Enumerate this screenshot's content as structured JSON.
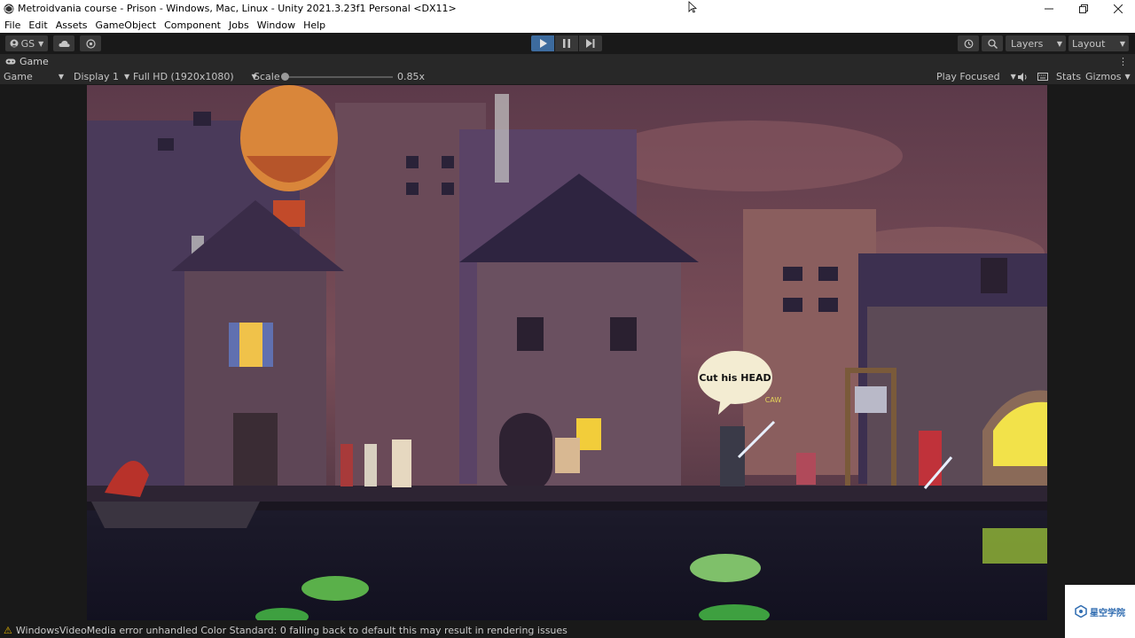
{
  "window": {
    "title": "Metroidvania course - Prison - Windows, Mac, Linux - Unity 2021.3.23f1 Personal <DX11>",
    "controls": [
      "minimize",
      "restore",
      "close"
    ]
  },
  "menu": [
    "File",
    "Edit",
    "Assets",
    "GameObject",
    "Component",
    "Jobs",
    "Window",
    "Help"
  ],
  "toolbar": {
    "account_label": "GS",
    "layers_label": "Layers",
    "layout_label": "Layout",
    "play_active": true
  },
  "game_tab": {
    "label": "Game"
  },
  "game_bar": {
    "view_mode": "Game",
    "display": "Display 1",
    "resolution": "Full HD (1920x1080)",
    "scale_label": "Scale",
    "scale_value": "0.85x",
    "play_mode": "Play Focused",
    "stats_label": "Stats",
    "gizmos_label": "Gizmos"
  },
  "game_view": {
    "speech_bubble": "Cut his HEAD",
    "caw_text": "CAW"
  },
  "status": {
    "icon": "warning-icon",
    "message": "WindowsVideoMedia error unhandled Color Standard: 0  falling back to default this may result in rendering issues"
  },
  "watermark": {
    "text": "星空学院"
  },
  "colors": {
    "editor_bg": "#191919",
    "panel_bg": "#282828",
    "play_active": "#3d6b9e",
    "warning": "#e0b000"
  }
}
